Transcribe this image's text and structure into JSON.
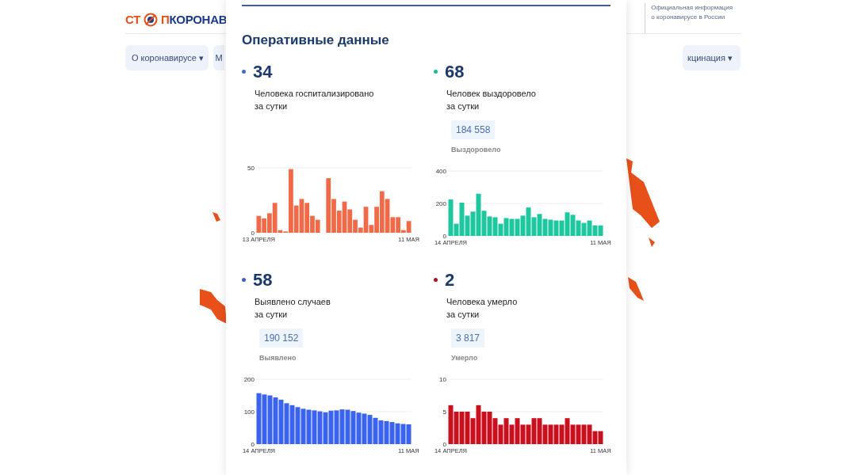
{
  "logo": {
    "part_1": "СТ",
    "part_2": "П",
    "part_3": "КОРОНАВ"
  },
  "header_info": {
    "line_1": "Официальная информация",
    "line_2": "о коронавирусе в России"
  },
  "nav": [
    {
      "label": "О коронавирусе",
      "caret": "▾"
    },
    {
      "label": "М"
    },
    {
      "label": "кцинация",
      "caret": "▾"
    }
  ],
  "panel": {
    "title": "Оперативные данные",
    "stats": [
      {
        "value": "34",
        "color": "#4a68c8",
        "label_1": "Человека госпитализировано",
        "label_2": "за сутки",
        "chart_data": {
          "type": "bar",
          "categories": [
            "13 АПРЕЛЯ",
            null,
            null,
            null,
            null,
            null,
            null,
            null,
            null,
            null,
            null,
            null,
            null,
            null,
            null,
            null,
            null,
            null,
            null,
            null,
            null,
            null,
            null,
            null,
            null,
            null,
            null,
            null,
            "11 МАЯ"
          ],
          "series": [
            {
              "color": "#f06a48",
              "values": [
                13,
                11,
                15,
                23,
                2,
                1,
                49,
                21,
                26,
                23,
                13,
                10,
                null,
                42,
                26,
                17,
                24,
                18,
                10,
                4,
                20,
                6,
                20,
                32,
                26,
                12,
                12,
                2,
                9
              ]
            }
          ],
          "ylim": [
            0,
            50
          ],
          "yticks": [
            0,
            50
          ]
        }
      },
      {
        "value": "68",
        "color": "#20b89a",
        "label_1": "Человек выздоровело",
        "label_2": "за сутки",
        "total": "184 558",
        "total_label": "Выздоровело",
        "chart_data": {
          "type": "bar",
          "categories": [
            "14 АПРЕЛЯ",
            null,
            null,
            null,
            null,
            null,
            null,
            null,
            null,
            null,
            null,
            null,
            null,
            null,
            null,
            null,
            null,
            null,
            null,
            null,
            null,
            null,
            null,
            null,
            null,
            null,
            null,
            "11 МАЯ"
          ],
          "series": [
            {
              "color": "#1ec7a0",
              "values": [
                225,
                75,
                205,
                125,
                150,
                260,
                155,
                120,
                115,
                75,
                110,
                105,
                105,
                125,
                175,
                115,
                135,
                105,
                100,
                95,
                95,
                145,
                130,
                95,
                80,
                95,
                65,
                65
              ]
            }
          ],
          "ylim": [
            0,
            400
          ],
          "yticks": [
            0,
            200,
            400
          ]
        }
      },
      {
        "value": "58",
        "color": "#3d5fcf",
        "label_1": "Выявлено случаев",
        "label_2": "за сутки",
        "total": "190 152",
        "total_label": "Выявлено",
        "chart_data": {
          "type": "bar",
          "categories": [
            "14 АПРЕЛЯ",
            null,
            null,
            null,
            null,
            null,
            null,
            null,
            null,
            null,
            null,
            null,
            null,
            null,
            null,
            null,
            null,
            null,
            null,
            null,
            null,
            null,
            null,
            null,
            null,
            null,
            null,
            "11 МАЯ"
          ],
          "series": [
            {
              "color": "#3a63f0",
              "values": [
                157,
                153,
                150,
                144,
                137,
                126,
                120,
                114,
                109,
                106,
                104,
                101,
                98,
                103,
                104,
                107,
                106,
                102,
                97,
                94,
                90,
                81,
                73,
                71,
                68,
                64,
                62,
                61
              ]
            }
          ],
          "ylim": [
            0,
            200
          ],
          "yticks": [
            0,
            100,
            200
          ]
        }
      },
      {
        "value": "2",
        "color": "#b0121b",
        "label_1": "Человека умерло",
        "label_2": "за сутки",
        "total": "3 817",
        "total_label": "Умерло",
        "chart_data": {
          "type": "bar",
          "categories": [
            "14 АПРЕЛЯ",
            null,
            null,
            null,
            null,
            null,
            null,
            null,
            null,
            null,
            null,
            null,
            null,
            null,
            null,
            null,
            null,
            null,
            null,
            null,
            null,
            null,
            null,
            null,
            null,
            null,
            null,
            "11 МАЯ"
          ],
          "series": [
            {
              "color": "#c8101e",
              "values": [
                6,
                5,
                5,
                5,
                4,
                6,
                5,
                5,
                4,
                3,
                4,
                3,
                4,
                3,
                3,
                4,
                4,
                3,
                3,
                3,
                3,
                4,
                3,
                3,
                3,
                3,
                2,
                2
              ]
            }
          ],
          "ylim": [
            0,
            10
          ],
          "yticks": [
            0,
            5,
            10
          ]
        }
      }
    ]
  }
}
